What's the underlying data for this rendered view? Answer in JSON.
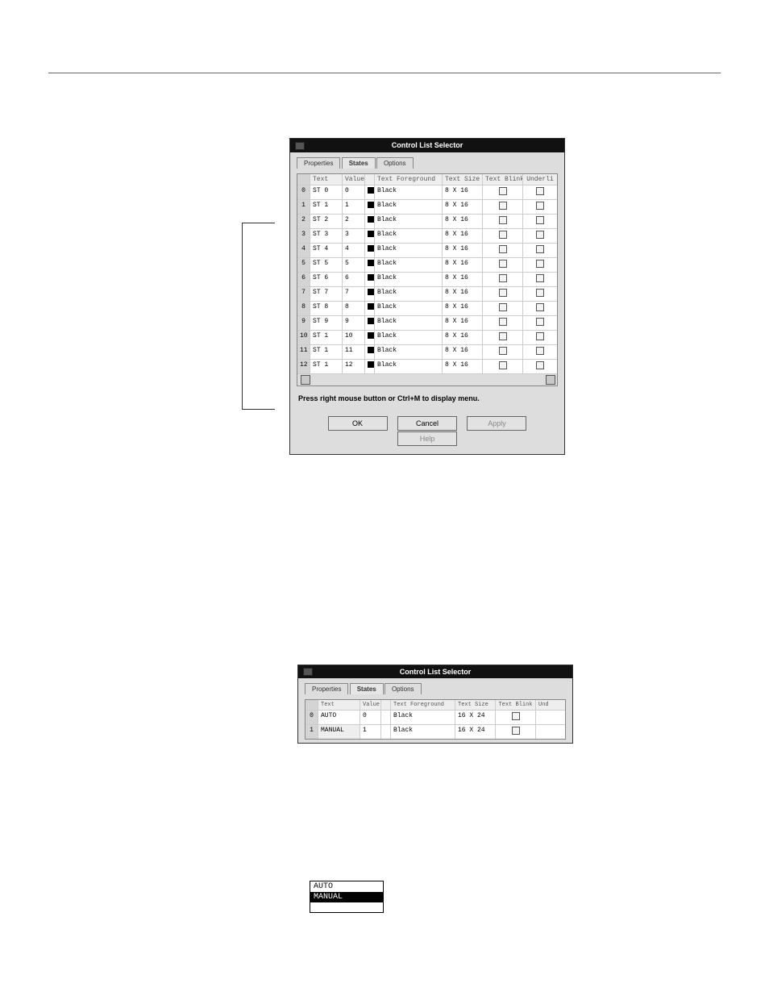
{
  "dialog1": {
    "title": "Control List Selector",
    "tabs": [
      "Properties",
      "States",
      "Options"
    ],
    "active_tab": 1,
    "headers": [
      "",
      "Text",
      "Value",
      "Text Foreground",
      "Text Size",
      "Text Blink",
      "Underli"
    ],
    "rows": [
      {
        "idx": "0",
        "text": "ST 0",
        "value": "0",
        "fg": "Black",
        "size": "8 X 16"
      },
      {
        "idx": "1",
        "text": "ST 1",
        "value": "1",
        "fg": "Black",
        "size": "8 X 16"
      },
      {
        "idx": "2",
        "text": "ST 2",
        "value": "2",
        "fg": "Black",
        "size": "8 X 16"
      },
      {
        "idx": "3",
        "text": "ST 3",
        "value": "3",
        "fg": "Black",
        "size": "8 X 16"
      },
      {
        "idx": "4",
        "text": "ST 4",
        "value": "4",
        "fg": "Black",
        "size": "8 X 16"
      },
      {
        "idx": "5",
        "text": "ST 5",
        "value": "5",
        "fg": "Black",
        "size": "8 X 16"
      },
      {
        "idx": "6",
        "text": "ST 6",
        "value": "6",
        "fg": "Black",
        "size": "8 X 16"
      },
      {
        "idx": "7",
        "text": "ST 7",
        "value": "7",
        "fg": "Black",
        "size": "8 X 16"
      },
      {
        "idx": "8",
        "text": "ST 8",
        "value": "8",
        "fg": "Black",
        "size": "8 X 16"
      },
      {
        "idx": "9",
        "text": "ST 9",
        "value": "9",
        "fg": "Black",
        "size": "8 X 16"
      },
      {
        "idx": "10",
        "text": "ST 1",
        "value": "10",
        "fg": "Black",
        "size": "8 X 16"
      },
      {
        "idx": "11",
        "text": "ST 1",
        "value": "11",
        "fg": "Black",
        "size": "8 X 16"
      },
      {
        "idx": "12",
        "text": "ST 1",
        "value": "12",
        "fg": "Black",
        "size": "8 X 16"
      }
    ],
    "hint": "Press right mouse button or Ctrl+M to display menu.",
    "buttons": {
      "ok": "OK",
      "cancel": "Cancel",
      "apply": "Apply",
      "help": "Help"
    }
  },
  "dialog2": {
    "title": "Control List Selector",
    "tabs": [
      "Properties",
      "States",
      "Options"
    ],
    "active_tab": 1,
    "headers": [
      "",
      "Text",
      "Value",
      "Text Foreground",
      "Text Size",
      "Text Blink",
      "Und"
    ],
    "rows": [
      {
        "idx": "0",
        "text": "AUTO",
        "value": "0",
        "fg": "Black",
        "size": "16 X 24"
      },
      {
        "idx": "1",
        "text": "MANUAL",
        "value": "1",
        "fg": "Black",
        "size": "16 X 24"
      }
    ]
  },
  "preview": {
    "line0": "AUTO",
    "line1": "MANUAL"
  }
}
